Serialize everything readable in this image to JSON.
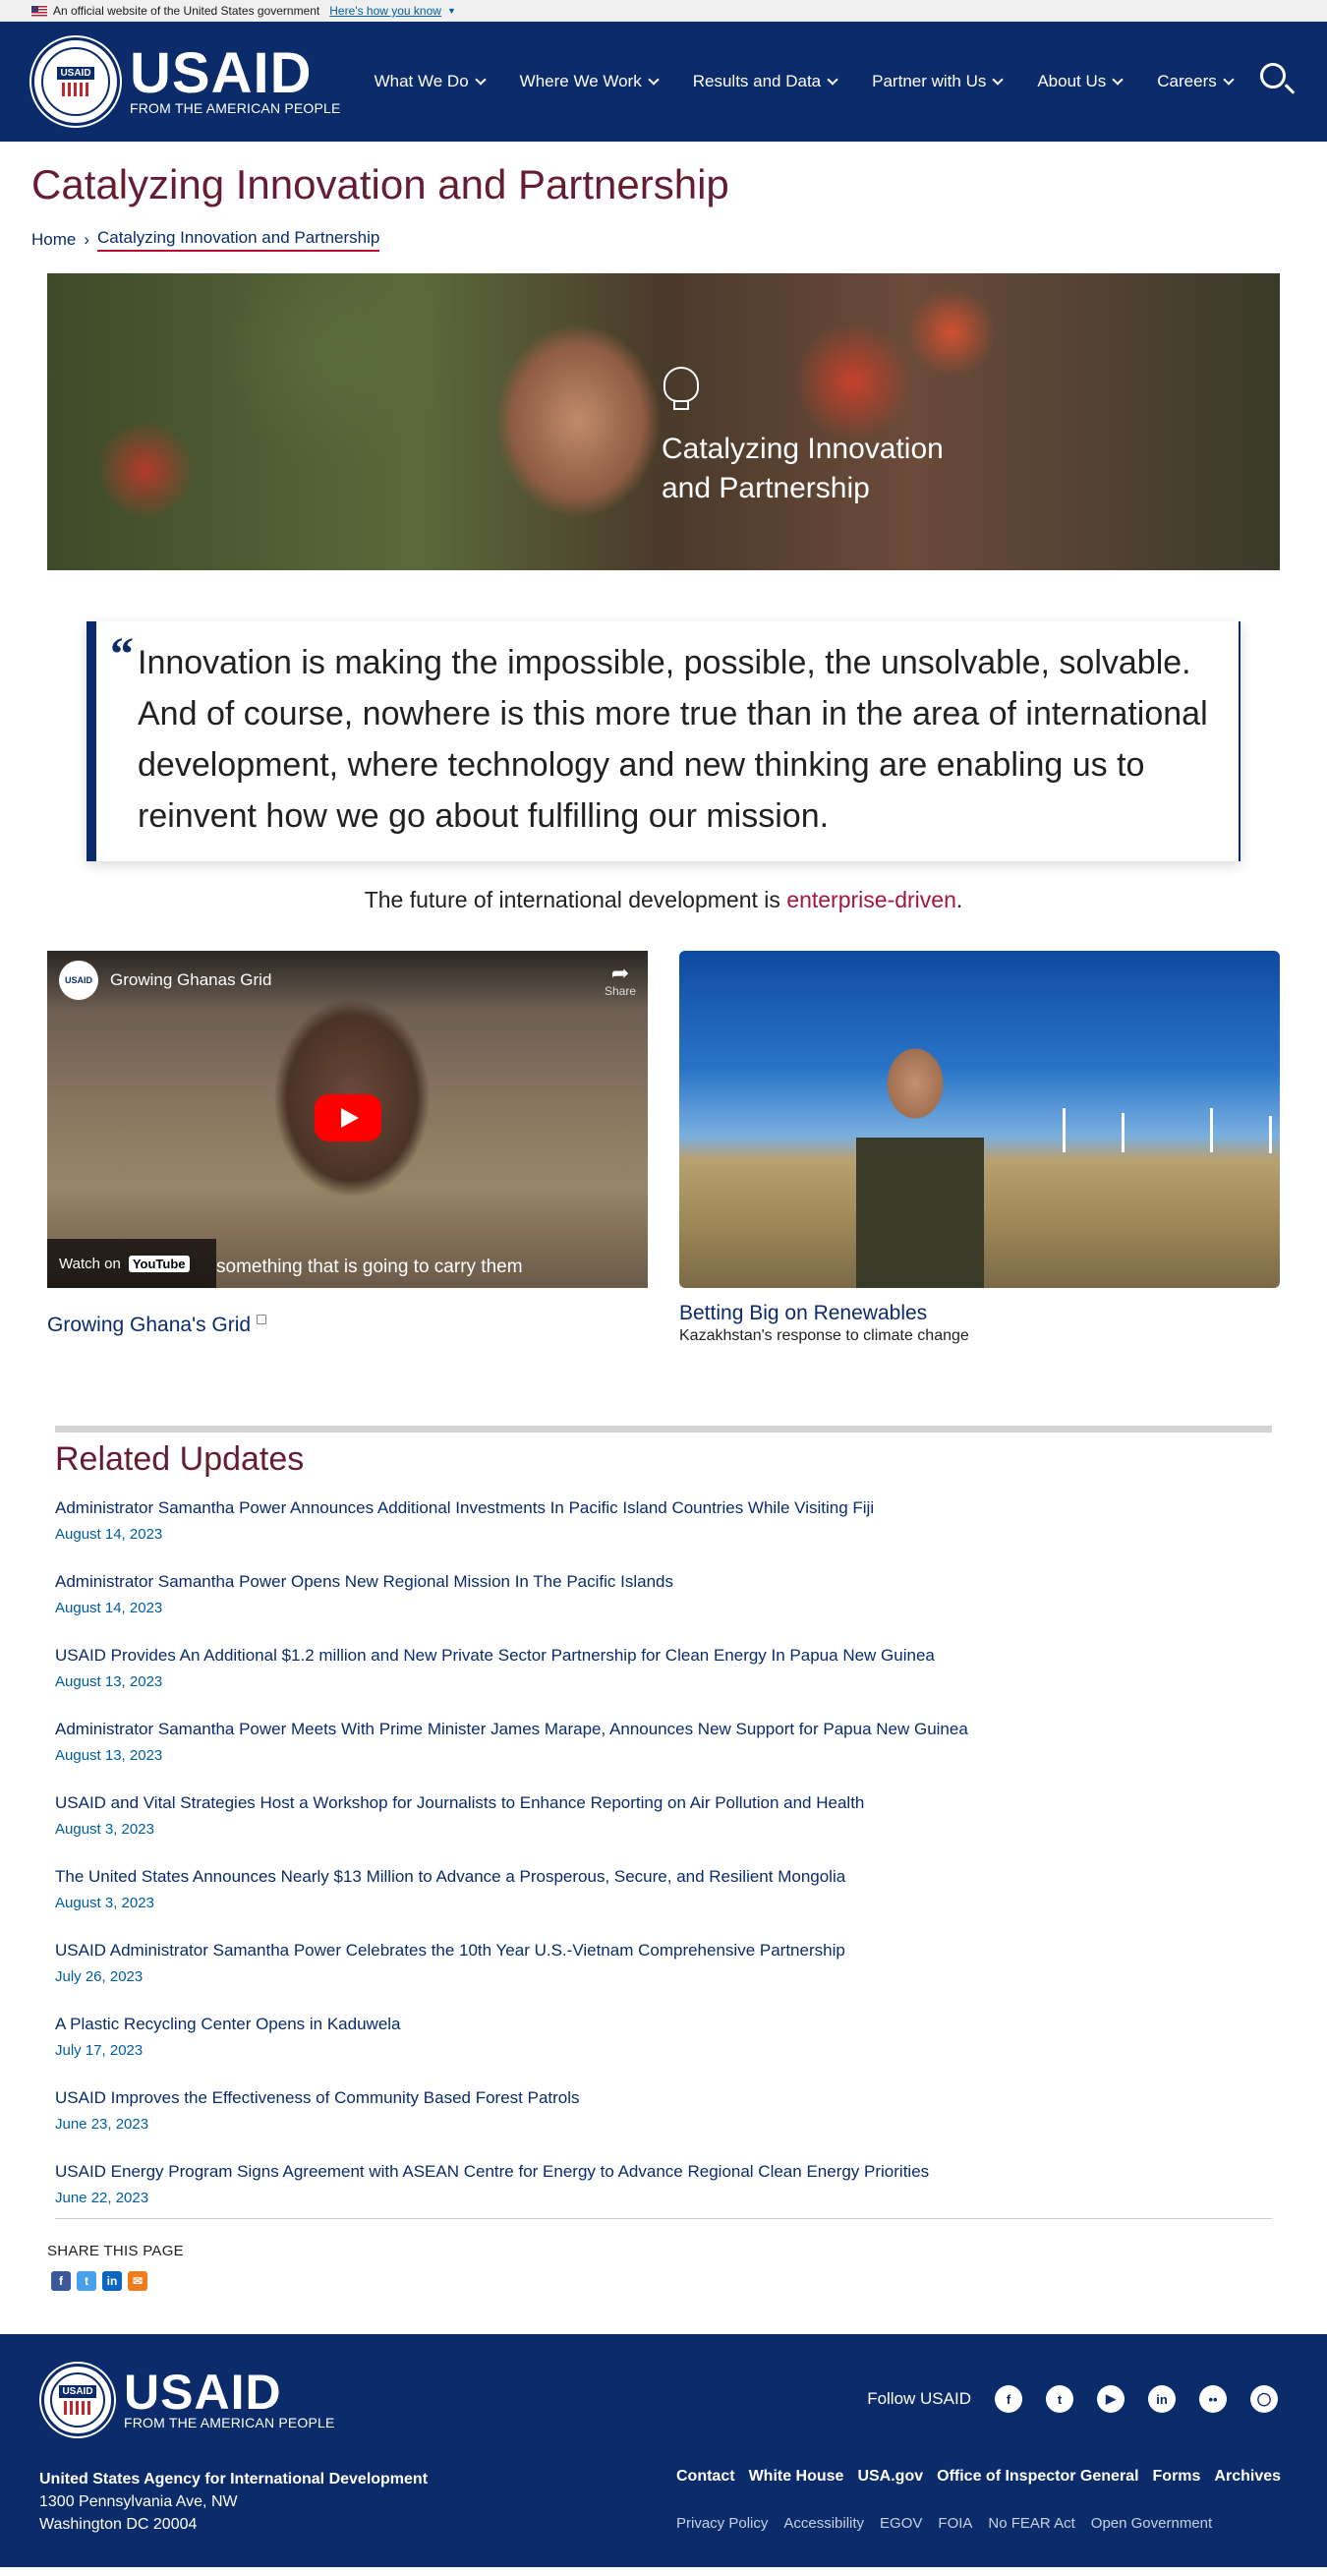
{
  "gov_banner": {
    "text": "An official website of the United States government",
    "link": "Here's how you know"
  },
  "header": {
    "seal_label": "USAID",
    "logo_word": "USAID",
    "logo_sub": "FROM THE AMERICAN PEOPLE",
    "nav": [
      "What We Do",
      "Where We Work",
      "Results and Data",
      "Partner with Us",
      "About Us",
      "Careers"
    ]
  },
  "page": {
    "title": "Catalyzing Innovation and Partnership",
    "breadcrumb_home": "Home",
    "breadcrumb_current": "Catalyzing Innovation and Partnership"
  },
  "hero": {
    "line1": "Catalyzing Innovation",
    "line2": "and Partnership"
  },
  "quote": {
    "mark": "“",
    "text": "Innovation is making the impossible, possible, the unsolvable, solvable. And of course, nowhere is this more true than in the area of international development, where technology and new thinking are enabling us to reinvent how we go about fulfilling our mission."
  },
  "tagline": {
    "prefix": "The future of international development is ",
    "accent": "enterprise-driven",
    "suffix": "."
  },
  "video": {
    "channel": "USAID",
    "title": "Growing Ghanas Grid",
    "share": "Share",
    "watch_on": "Watch on",
    "youtube": "YouTube",
    "caption": "something that is going to carry them",
    "link_title": "Growing Ghana's Grid"
  },
  "photo_card": {
    "title": "Betting Big on Renewables",
    "subtitle": "Kazakhstan's response to climate change"
  },
  "related": {
    "heading": "Related Updates",
    "items": [
      {
        "title": "Administrator Samantha Power Announces Additional Investments In Pacific Island Countries While Visiting Fiji",
        "date": "August 14, 2023"
      },
      {
        "title": "Administrator Samantha Power Opens New Regional Mission In The Pacific Islands",
        "date": "August 14, 2023"
      },
      {
        "title": "USAID Provides An Additional $1.2 million and New Private Sector Partnership for Clean Energy In Papua New Guinea",
        "date": "August 13, 2023"
      },
      {
        "title": "Administrator Samantha Power Meets With Prime Minister James Marape, Announces New Support for Papua New Guinea",
        "date": "August 13, 2023"
      },
      {
        "title": "USAID and Vital Strategies Host a Workshop for Journalists to Enhance Reporting on Air Pollution and Health",
        "date": "August 3, 2023"
      },
      {
        "title": "The United States Announces Nearly $13 Million to Advance a Prosperous, Secure, and Resilient Mongolia",
        "date": "August 3, 2023"
      },
      {
        "title": "USAID Administrator Samantha Power Celebrates the 10th Year U.S.-Vietnam Comprehensive Partnership",
        "date": "July 26, 2023"
      },
      {
        "title": "A Plastic Recycling Center Opens in Kaduwela",
        "date": "July 17, 2023"
      },
      {
        "title": "USAID Improves the Effectiveness of Community Based Forest Patrols",
        "date": "June 23, 2023"
      },
      {
        "title": "USAID Energy Program Signs Agreement with ASEAN Centre for Energy to Advance Regional Clean Energy Priorities",
        "date": "June 22, 2023"
      }
    ]
  },
  "share_page": {
    "label": "SHARE THIS PAGE"
  },
  "footer": {
    "follow": "Follow USAID",
    "agency_name": "United States Agency for International Development",
    "address1": "1300 Pennsylvania Ave, NW",
    "address2": "Washington DC 20004",
    "links": [
      "Contact",
      "White House",
      "USA.gov",
      "Office of Inspector General",
      "Forms",
      "Archives"
    ],
    "sublinks": [
      "Privacy Policy",
      "Accessibility",
      "EGOV",
      "FOIA",
      "No FEAR Act",
      "Open Government"
    ]
  },
  "colors": {
    "navy": "#0b2b6b",
    "maroon": "#651d32",
    "accent": "#a3163f",
    "link": "#005ea2"
  }
}
